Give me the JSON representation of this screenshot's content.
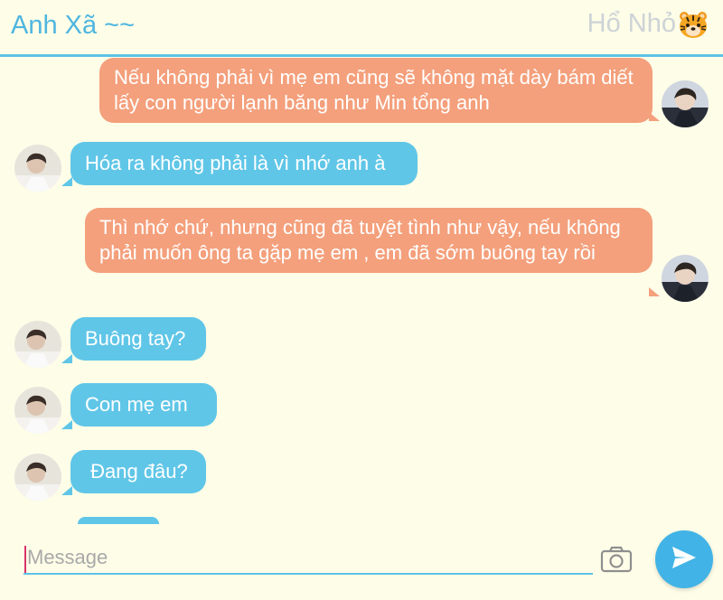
{
  "header": {
    "left_title": "Anh Xã ~~",
    "right_title": "Hổ Nhỏ",
    "right_emoji": "tiger-face",
    "accent": "#5ec3e6"
  },
  "messages": [
    {
      "side": "out",
      "text": "Nếu không phải vì mẹ em cũng sẽ không mặt dày bám diết lấy con người lạnh băng như Min tổng anh"
    },
    {
      "side": "in",
      "text": "Hóa ra không phải là vì nhớ anh à"
    },
    {
      "side": "out",
      "text": "Thì nhớ chứ, nhưng cũng đã tuyệt tình như vậy, nếu không phải muốn ông ta gặp mẹ em , em đã sớm buông tay rồi"
    },
    {
      "side": "in",
      "text": "Buông tay?"
    },
    {
      "side": "in",
      "text": "Con mẹ em"
    },
    {
      "side": "in",
      "text": " Đang đâu?"
    }
  ],
  "composer": {
    "placeholder": "Message",
    "camera_icon": "camera-icon",
    "send_icon": "send-icon",
    "send_color": "#42b3e6"
  },
  "colors": {
    "background": "#fdfde8",
    "outgoing_bubble": "#f4a07c",
    "incoming_bubble": "#60c6e7"
  }
}
